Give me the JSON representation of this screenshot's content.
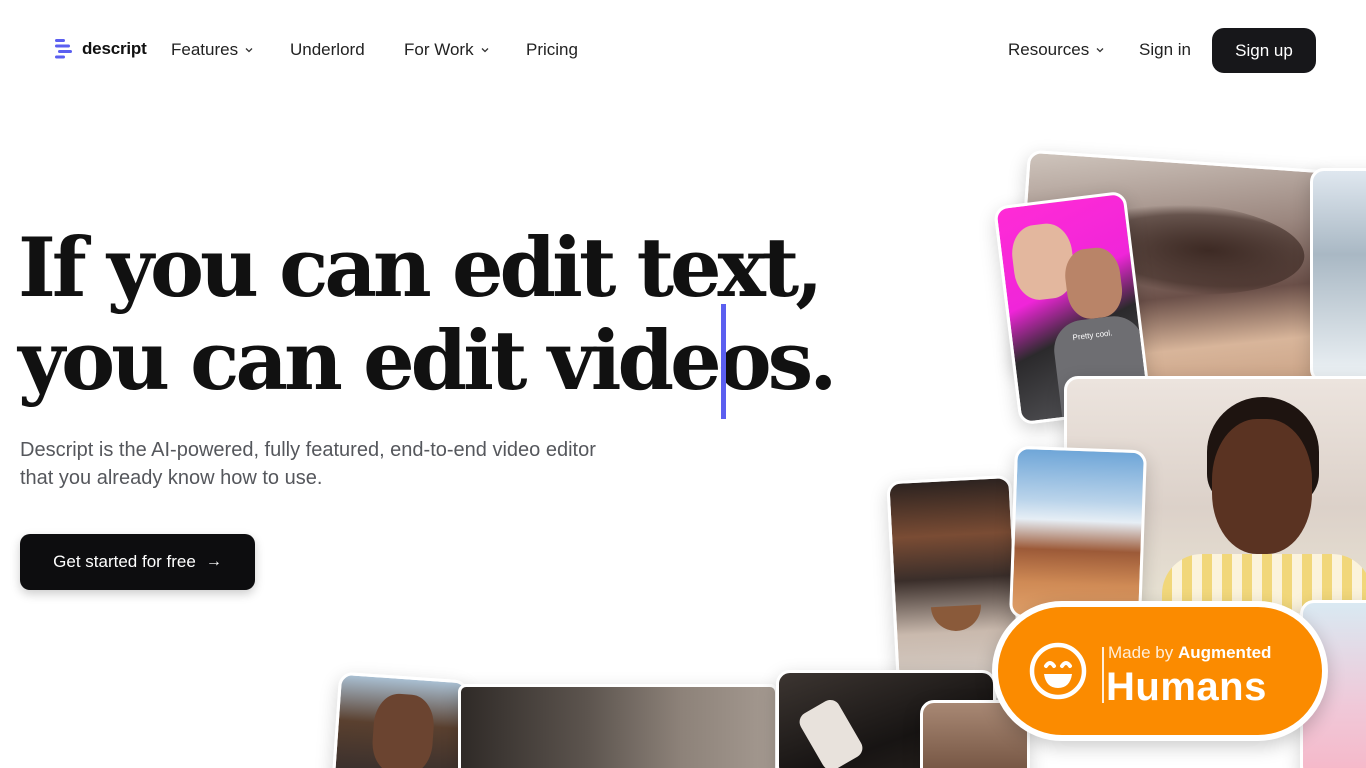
{
  "nav": {
    "logo_text": "descript",
    "items": [
      {
        "label": "Features",
        "has_dropdown": true
      },
      {
        "label": "Underlord",
        "has_dropdown": false
      },
      {
        "label": "For Work",
        "has_dropdown": true
      },
      {
        "label": "Pricing",
        "has_dropdown": false
      }
    ],
    "resources": {
      "label": "Resources",
      "has_dropdown": true
    },
    "sign_in": "Sign in",
    "sign_up": "Sign up"
  },
  "hero": {
    "headline_line1": "If you can edit text,",
    "headline_line2": "you can edit videos.",
    "subtitle_line1": "Descript is the AI-powered, fully featured, end-to-end video editor",
    "subtitle_line2": "that you already know how to use.",
    "cta": "Get started for free",
    "cta_icon": "arrow-right-icon"
  },
  "media": {
    "friends_overlay_text": "Pretty cool."
  },
  "badge": {
    "made_by": "Made by",
    "augmented": "Augmented",
    "humans": "Humans",
    "icon": "smiley-icon",
    "color": "#fb8b00"
  },
  "colors": {
    "accent": "#5b5ff0",
    "button_dark": "#17171a"
  }
}
